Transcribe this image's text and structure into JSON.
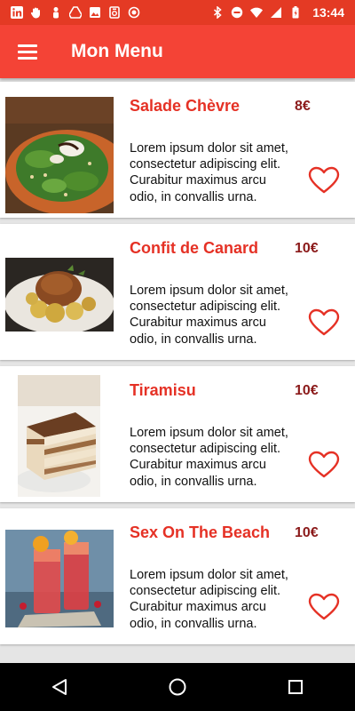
{
  "status_bar": {
    "time": "13:44",
    "left_icons": [
      "linkedin-icon",
      "hand-icon",
      "person-icon",
      "drive-icon",
      "image-icon",
      "box-icon",
      "circle-icon"
    ],
    "right_icons": [
      "bluetooth-icon",
      "minus-circle-icon",
      "wifi-icon",
      "signal-icon",
      "battery-icon"
    ]
  },
  "app_bar": {
    "title": "Mon Menu",
    "menu_icon": "hamburger-menu-icon",
    "color": "#f44336"
  },
  "menu_items": [
    {
      "name": "Salade Chèvre",
      "price": "8€",
      "description": "Lorem ipsum dolor sit amet, consectetur adipiscing elit. Curabitur maximus arcu odio, in convallis urna.",
      "image": "salad-image",
      "favorite": false
    },
    {
      "name": "Confit de Canard",
      "price": "10€",
      "description": "Lorem ipsum dolor sit amet, consectetur adipiscing elit. Curabitur maximus arcu odio, in convallis urna.",
      "image": "duck-confit-image",
      "favorite": false
    },
    {
      "name": "Tiramisu",
      "price": "10€",
      "description": "Lorem ipsum dolor sit amet, consectetur adipiscing elit. Curabitur maximus arcu odio, in convallis urna.",
      "image": "tiramisu-image",
      "favorite": false
    },
    {
      "name": "Sex On The Beach",
      "price": "10€",
      "description": "Lorem ipsum dolor sit amet, consectetur adipiscing elit. Curabitur maximus arcu odio, in convallis urna.",
      "image": "cocktail-image",
      "favorite": false
    }
  ],
  "nav_bar": {
    "buttons": [
      "back-icon",
      "home-icon",
      "recents-icon"
    ]
  }
}
